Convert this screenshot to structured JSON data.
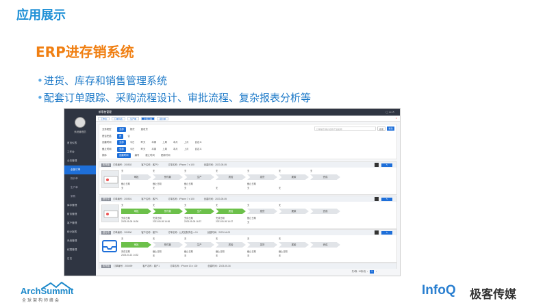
{
  "slide": {
    "title": "应用展示",
    "section_title": "ERP进存销系统",
    "bullets": [
      "进货、库存和销售管理系统",
      "配套订单跟踪、采购流程设计、审批流程、复杂报表分析等"
    ]
  },
  "app": {
    "topbar_title": "新零售管理",
    "sidebar": {
      "user": "系统管理员",
      "items": [
        {
          "label": "首页仪表",
          "sub": false,
          "active": false
        },
        {
          "label": "工作台",
          "sub": false,
          "active": false
        },
        {
          "label": "业务管理",
          "sub": false,
          "active": false
        },
        {
          "label": "全部订单",
          "sub": true,
          "active": true
        },
        {
          "label": "报价单",
          "sub": true,
          "active": false
        },
        {
          "label": "生产单",
          "sub": true,
          "active": false
        },
        {
          "label": "采购",
          "sub": true,
          "active": false
        },
        {
          "label": "库存管理",
          "sub": false,
          "active": false
        },
        {
          "label": "财务管理",
          "sub": false,
          "active": false
        },
        {
          "label": "客户管理",
          "sub": false,
          "active": false
        },
        {
          "label": "统计报表",
          "sub": false,
          "active": false
        },
        {
          "label": "系统管理",
          "sub": false,
          "active": false
        },
        {
          "label": "权限管理",
          "sub": false,
          "active": false
        },
        {
          "label": "日志",
          "sub": false,
          "active": false
        }
      ]
    },
    "tabs": [
      "工作台",
      "订单列表",
      "生产单",
      "全部订单",
      "报价单"
    ],
    "active_tab": 3,
    "filter": {
      "rows": [
        {
          "label": "业务类型",
          "chips": [
            "全部",
            "报货",
            "直发货"
          ]
        },
        {
          "label": "是否完结",
          "chips": [
            "是",
            "否"
          ]
        },
        {
          "label": "创建时间",
          "chips": [
            "全部",
            "今日",
            "昨天",
            "本周",
            "上周",
            "本月",
            "上月",
            "自定义"
          ]
        },
        {
          "label": "截止时间",
          "chips": [
            "全部",
            "今日",
            "昨天",
            "本周",
            "上周",
            "本月",
            "上月",
            "自定义"
          ]
        },
        {
          "label": "排序",
          "chips": [
            "创建时间",
            "编号",
            "截止时间",
            "更新时间"
          ]
        }
      ],
      "search_placeholder": "订单编号/客户名称/产品名称",
      "search_button": "搜索",
      "add_button": "新建"
    },
    "orders": [
      {
        "status": "未开始",
        "order_no": "订单编号：200502",
        "customer": "客户名称：客户0",
        "product": "订单名称：iPhone 7 x 100",
        "created": "创建时间：2023-05-05",
        "steps": [
          {
            "name": "审批",
            "done": false
          },
          {
            "name": "预付款",
            "done": false
          },
          {
            "name": "生产",
            "done": false
          },
          {
            "name": "质检",
            "done": false
          },
          {
            "name": "发货",
            "done": false
          },
          {
            "name": "尾款",
            "done": false
          },
          {
            "name": "完成",
            "done": false
          }
        ],
        "top": [
          "无",
          "无",
          "无",
          "无",
          "无",
          "无",
          "无"
        ],
        "dates": [
          "截止日期",
          "截止日期",
          "截止日期",
          "",
          "截止日期",
          "",
          ""
        ],
        "bottom": [
          "无",
          "无",
          "无",
          "无",
          "无",
          "无",
          ""
        ],
        "thumb": "photo"
      },
      {
        "status": "进行中",
        "order_no": "订单编号：200501",
        "customer": "客户名称：客户1",
        "product": "订单名称：iPhone 7 x 100",
        "created": "创建时间：2023-05-05",
        "steps": [
          {
            "name": "审批",
            "done": true
          },
          {
            "name": "预付款",
            "done": true
          },
          {
            "name": "生产",
            "done": true
          },
          {
            "name": "质检",
            "done": true
          },
          {
            "name": "发货",
            "done": false
          },
          {
            "name": "尾款",
            "done": false
          },
          {
            "name": "完成",
            "done": false
          }
        ],
        "top": [
          "无",
          "无",
          "无",
          "无",
          "无",
          "无",
          ""
        ],
        "dates": [
          "完成日期",
          "完成日期",
          "完成日期",
          "完成日期",
          "截止日期",
          "",
          ""
        ],
        "bottom": [
          "2023-05-05 16:36",
          "2023-05-05 16:36",
          "2023-05-05 16:37",
          "2023-05-05 16:37",
          "无",
          "",
          ""
        ],
        "thumb": "photo"
      },
      {
        "status": "进行中",
        "order_no": "订单编号：200500",
        "customer": "客户名称：客户1",
        "product": "订单名称：公关定制背包 x 10",
        "created": "创建时间：2023-04-03",
        "steps": [
          {
            "name": "审批",
            "done": true
          },
          {
            "name": "预付款",
            "done": false
          },
          {
            "name": "生产",
            "done": false
          },
          {
            "name": "质检",
            "done": false
          },
          {
            "name": "发货",
            "done": false
          },
          {
            "name": "尾款",
            "done": false
          },
          {
            "name": "完成",
            "done": false
          }
        ],
        "top": [
          "无",
          "无",
          "无",
          "无",
          "无",
          "无",
          ""
        ],
        "dates": [
          "完成日期",
          "截止日期",
          "截止日期",
          "截止日期",
          "截止日期",
          "截止日期",
          ""
        ],
        "bottom": [
          "2023-04-13 14:32",
          "无",
          "无",
          "无",
          "无",
          "无",
          ""
        ],
        "thumb": "tray"
      }
    ],
    "last_order": {
      "status": "未开始",
      "order_no": "订单编号：200499",
      "customer": "客户名称：客户1",
      "product": "订单名称：iPhone 13 x 100",
      "created": "创建时间：2023-05-16"
    },
    "pager": {
      "total": "共4条",
      "page_size": "10条/页",
      "current": "1"
    }
  },
  "footer": {
    "archsummit_name": "ArchSummit",
    "archsummit_sub": "全球架构师峰会",
    "infoq_name": "InfoQ",
    "infoq_cn": "极客传媒"
  }
}
